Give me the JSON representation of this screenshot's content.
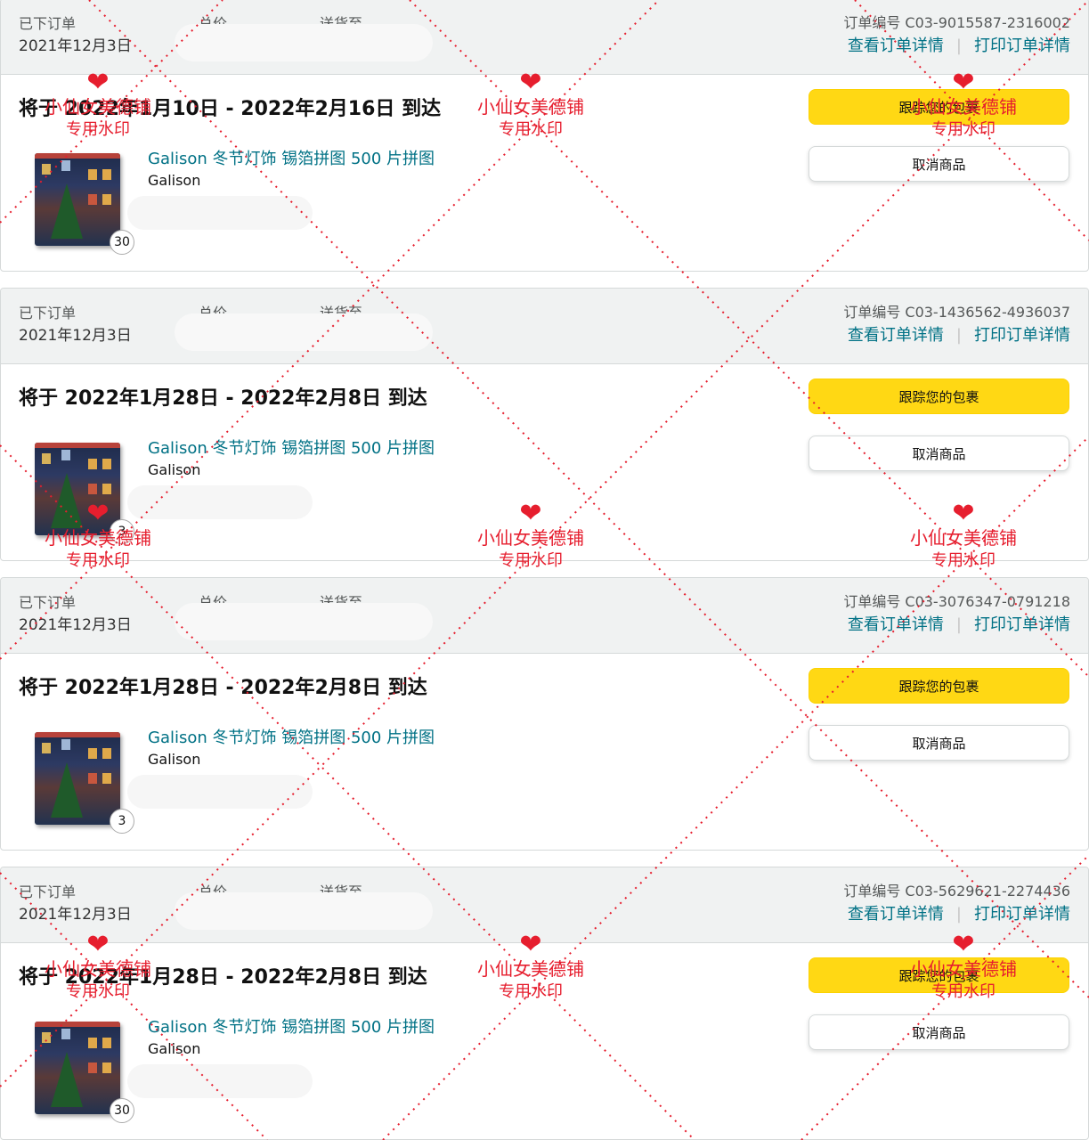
{
  "labels": {
    "placed": "已下订单",
    "total": "总价",
    "ship_to": "送货至",
    "view_details": "查看订单详情",
    "print_details": "打印订单详情",
    "track_package": "跟踪您的包裹",
    "cancel_item": "取消商品"
  },
  "orders": [
    {
      "placed_date": "2021年12月3日",
      "order_number": "订单编号 C03-9015587-2316002",
      "arrival": "将于 2022年1月10日 - 2022年2月16日 到达",
      "product_title": "Galison 冬节灯饰 锡箔拼图 500 片拼图",
      "brand": "Galison",
      "quantity": "30"
    },
    {
      "placed_date": "2021年12月3日",
      "order_number": "订单编号 C03-1436562-4936037",
      "arrival": "将于 2022年1月28日 - 2022年2月8日 到达",
      "product_title": "Galison 冬节灯饰 锡箔拼图 500 片拼图",
      "brand": "Galison",
      "quantity": "3"
    },
    {
      "placed_date": "2021年12月3日",
      "order_number": "订单编号 C03-3076347-0791218",
      "arrival": "将于 2022年1月28日 - 2022年2月8日 到达",
      "product_title": "Galison 冬节灯饰 锡箔拼图 500 片拼图",
      "brand": "Galison",
      "quantity": "3"
    },
    {
      "placed_date": "2021年12月3日",
      "order_number": "订单编号 C03-5629621-2274436",
      "arrival": "将于 2022年1月28日 - 2022年2月8日 到达",
      "product_title": "Galison 冬节灯饰 锡箔拼图 500 片拼图",
      "brand": "Galison",
      "quantity": "30"
    }
  ],
  "watermark": {
    "line1": "小仙女美德铺",
    "line2": "专用水印",
    "color": "#e61e2e"
  },
  "colors": {
    "link": "#007185",
    "track_button": "#ffd814",
    "header_bg": "#f0f2f2"
  }
}
